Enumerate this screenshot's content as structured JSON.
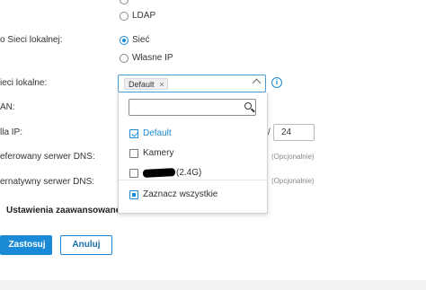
{
  "form": {
    "ldap_label": "LDAP",
    "dhcp_server_label": "o Sieci lokalnej:",
    "radio_network": "Sieć",
    "radio_custom_ip": "Własne IP",
    "local_networks_label": "ieci lokalne:",
    "lan_label": "AN:",
    "ip_range_label": "lla IP:",
    "ip_range_slash": "/",
    "ip_range_prefix": "24",
    "preferred_dns_label": "eferowany serwer DNS:",
    "alternate_dns_label": "ernatywny serwer DNS:",
    "optional_hint_1": "(Opcjonalnie)",
    "optional_hint_2": "(Opcjonalnie)",
    "advanced_settings": "Ustawienia zaawansowane"
  },
  "select": {
    "chip_label": "Default",
    "chip_remove": "×",
    "info_glyph": "i"
  },
  "dropdown": {
    "search_placeholder": "",
    "items": [
      {
        "label": "Default",
        "checked": true
      },
      {
        "label": "Kamery",
        "checked": false
      },
      {
        "label": "(2.4G)",
        "checked": false
      }
    ],
    "select_all": "Zaznacz wszystkie"
  },
  "actions": {
    "apply": "Zastosuj",
    "cancel": "Anuluj"
  },
  "colors": {
    "accent": "#1a8ad6"
  }
}
